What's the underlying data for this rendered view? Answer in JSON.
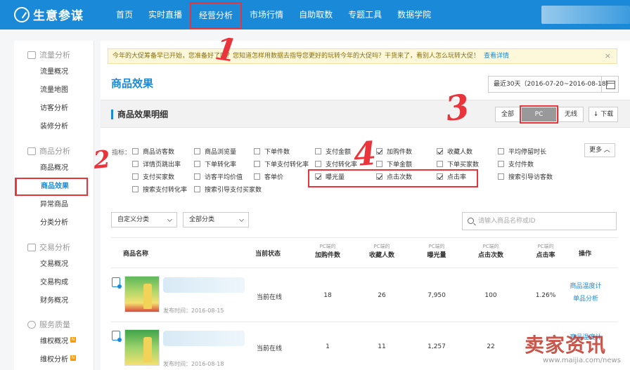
{
  "app": {
    "logo_text": "生意参谋"
  },
  "nav": {
    "items": [
      "首页",
      "实时直播",
      "经营分析",
      "市场行情",
      "自助取数",
      "专题工具",
      "数据学院"
    ],
    "active_index": 2
  },
  "sidebar": {
    "groups": [
      {
        "title": "流量分析",
        "icon": "chart-bar-icon",
        "items": [
          "流量概况",
          "流量地图",
          "访客分析",
          "装修分析"
        ]
      },
      {
        "title": "商品分析",
        "icon": "shop-bag-icon",
        "items": [
          "商品概况",
          "商品效果",
          "异常商品",
          "分类分析"
        ]
      },
      {
        "title": "交易分析",
        "icon": "cart-icon",
        "items": [
          "交易概况",
          "交易构成",
          "财务概况"
        ]
      },
      {
        "title": "服务质量",
        "icon": "headset-icon",
        "items": [
          "维权概况",
          "维权分析"
        ]
      }
    ],
    "active_item": "商品效果",
    "badge": "N"
  },
  "notice": {
    "text": "今年的大促筹备早已开始，您准备好了吗？您知道怎样用数据去指导您更好的玩转今年的大促吗？干货来了，看别人怎么玩转大促！",
    "link": "查看详情",
    "close": "×"
  },
  "page": {
    "title": "商品效果",
    "date_range": "最近30天（2016-07-20~2016-08-18）"
  },
  "section": {
    "title": "商品效果明细",
    "tabs": [
      "全部",
      "PC",
      "无线"
    ],
    "active_tab": "PC",
    "download": "↓ 下载"
  },
  "metrics": {
    "label": "指标：",
    "more": "更多 ︿",
    "items": [
      {
        "label": "商品访客数",
        "checked": false
      },
      {
        "label": "商品浏览量",
        "checked": false
      },
      {
        "label": "下单件数",
        "checked": false
      },
      {
        "label": "支付金额",
        "checked": false
      },
      {
        "label": "加购件数",
        "checked": true
      },
      {
        "label": "收藏人数",
        "checked": true
      },
      {
        "label": "平均停留时长",
        "checked": false
      },
      {
        "label": "详情页跳出率",
        "checked": false
      },
      {
        "label": "下单转化率",
        "checked": false
      },
      {
        "label": "下单支付转化率",
        "checked": false
      },
      {
        "label": "支付转化率",
        "checked": false
      },
      {
        "label": "下单金额",
        "checked": false
      },
      {
        "label": "下单买家数",
        "checked": false
      },
      {
        "label": "支付件数",
        "checked": false
      },
      {
        "label": "支付买家数",
        "checked": false
      },
      {
        "label": "访客平均价值",
        "checked": false
      },
      {
        "label": "客单价",
        "checked": false
      },
      {
        "label": "曝光量",
        "checked": true
      },
      {
        "label": "点击次数",
        "checked": true
      },
      {
        "label": "点击率",
        "checked": true
      },
      {
        "label": "搜索引导访客数",
        "checked": false
      },
      {
        "label": "搜索支付转化率",
        "checked": false
      },
      {
        "label": "搜索引导支付买家数",
        "checked": false
      }
    ]
  },
  "filters": {
    "custom_category": "自定义分类",
    "all_category": "全部分类",
    "search_placeholder": "请输入商品名称或ID"
  },
  "table": {
    "headers": {
      "name": "商品名称",
      "status": "当前状态",
      "cols": [
        {
          "sub": "PC端的",
          "label": "加购件数"
        },
        {
          "sub": "PC端的",
          "label": "收藏人数"
        },
        {
          "sub": "PC端的",
          "label": "曝光量"
        },
        {
          "sub": "PC端的",
          "label": "点击次数"
        },
        {
          "sub": "PC端的",
          "label": "点击率"
        }
      ],
      "action": "操作"
    },
    "rows": [
      {
        "publish": "发布时间：2016-08-15",
        "status": "当前在线",
        "values": [
          "18",
          "26",
          "7,950",
          "100",
          "1.26%"
        ],
        "actions": [
          "商品温度计",
          "单品分析"
        ]
      },
      {
        "publish": "发布时间：2016-08-18",
        "status": "当前在线",
        "values": [
          "1",
          "11",
          "1,257",
          "22",
          ""
        ],
        "actions": [
          "商品温度计",
          ""
        ]
      }
    ]
  },
  "annotations": [
    "1",
    "2",
    "3",
    "4"
  ],
  "watermark": {
    "brand": "卖家资讯",
    "url": "www.maijia.com/news"
  },
  "colors": {
    "accent": "#1a8ad8",
    "annotation": "#e8343a"
  }
}
